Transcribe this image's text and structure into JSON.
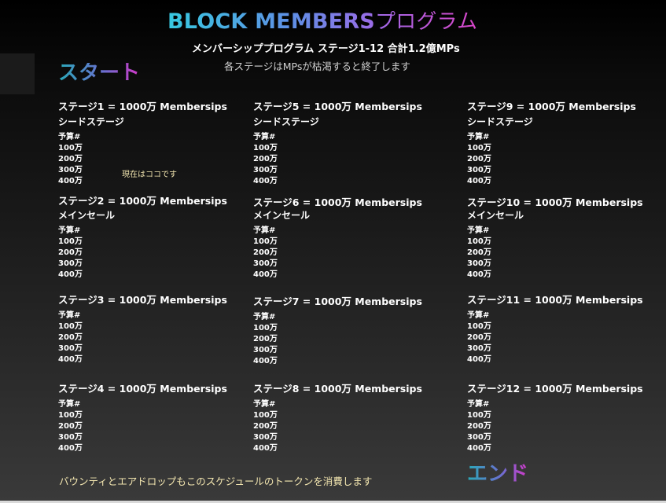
{
  "header": {
    "title_en": "BLOCK MEMBERS",
    "title_ja": "プログラム",
    "subtitle": "メンバーシッププログラム ステージ1-12 合計1.2億MPs",
    "note": "各ステージはMPsが枯渇すると終了します"
  },
  "start_label": "スタート",
  "end_label": "エンド",
  "current_marker": "現在はココです",
  "footer_note": "バウンティとエアドロップもこのスケジュールのトークンを消費します",
  "budget": {
    "label": "予算#",
    "rows": [
      "100万",
      "200万",
      "300万",
      "400万"
    ]
  },
  "stages": [
    {
      "title": "ステージ1 = 1000万 Membersips",
      "subtitle": "シードステージ"
    },
    {
      "title": "ステージ2 = 1000万 Membersips",
      "subtitle": "メインセール"
    },
    {
      "title": "ステージ3 = 1000万 Membersips",
      "subtitle": ""
    },
    {
      "title": "ステージ4 = 1000万 Membersips",
      "subtitle": ""
    },
    {
      "title": "ステージ5 = 1000万 Membersips",
      "subtitle": "シードステージ"
    },
    {
      "title": "ステージ6 = 1000万 Membersips",
      "subtitle": "メインセール"
    },
    {
      "title": "ステージ7 = 1000万 Membersips",
      "subtitle": ""
    },
    {
      "title": "ステージ8 = 1000万 Membersips",
      "subtitle": ""
    },
    {
      "title": "ステージ9 = 1000万 Membersips",
      "subtitle": "シードステージ"
    },
    {
      "title": "ステージ10 = 1000万 Membersips",
      "subtitle": "メインセール"
    },
    {
      "title": "ステージ11 = 1000万 Membersips",
      "subtitle": ""
    },
    {
      "title": "ステージ12 = 1000万 Membersips",
      "subtitle": ""
    }
  ]
}
